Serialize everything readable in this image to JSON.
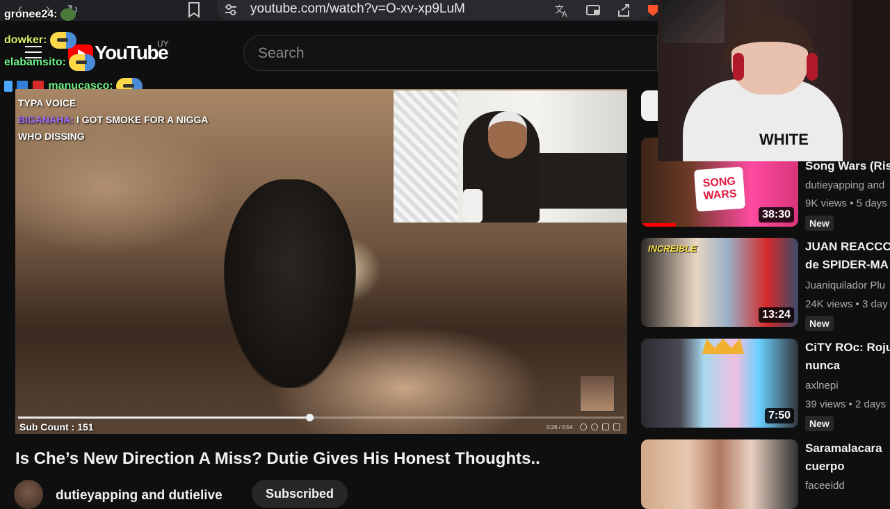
{
  "browser": {
    "url": "youtube.com/watch?v=O-xv-xp9LuM"
  },
  "header": {
    "brand": "YouTube",
    "country": "UY",
    "search_placeholder": "Search"
  },
  "chat": [
    {
      "user": "gronee24:",
      "color": "#ffffff"
    },
    {
      "user": "dowker:",
      "color": "#d7f26a"
    },
    {
      "user": "elabamsito:",
      "color": "#6ff08a"
    },
    {
      "user": "manucasco:",
      "color": "#6ff08a"
    }
  ],
  "player": {
    "caption_line1": "TYPA VOICE",
    "caption_line2_user": "BIGANAHA:",
    "caption_line2_text": "I GOT SMOKE FOR A NIGGA",
    "caption_line3": "WHO DISSING",
    "sub_count": "Sub Count : 151",
    "time": "0:26 / 0:54",
    "progress_fraction": 0.48
  },
  "video": {
    "title": "Is Che’s New Direction A Miss? Dutie Gives His Honest Thoughts..",
    "channel": "dutieyapping and dutielive",
    "subscribe_label": "Subscribed"
  },
  "recommendations": [
    {
      "title": "Song Wars (Ris",
      "channel": "dutieyapping and",
      "meta": "9K views • 5 days",
      "duration": "38:30",
      "badge": "New",
      "thumb_text": "SONG WARS",
      "progress_fraction": 0.22
    },
    {
      "title1": "JUAN REACCC",
      "title2": "de SPIDER-MA",
      "channel": "Juaniquilador Plu",
      "meta": "24K views • 3 day",
      "duration": "13:24",
      "badge": "New",
      "thumb_text": "INCREIBLE"
    },
    {
      "title1": "CiTY ROc: Roju",
      "title2": "nunca",
      "channel": "axlnepi",
      "meta": "39 views • 2 days",
      "duration": "7:50",
      "badge": "New"
    },
    {
      "title1": "Saramalacara",
      "title2": "cuerpo",
      "channel": "faceeidd"
    }
  ],
  "streamer_cam": {
    "shirt_text": "WHITE"
  },
  "colors": {
    "accent_red": "#ff0000",
    "background": "#0f0f0f"
  }
}
